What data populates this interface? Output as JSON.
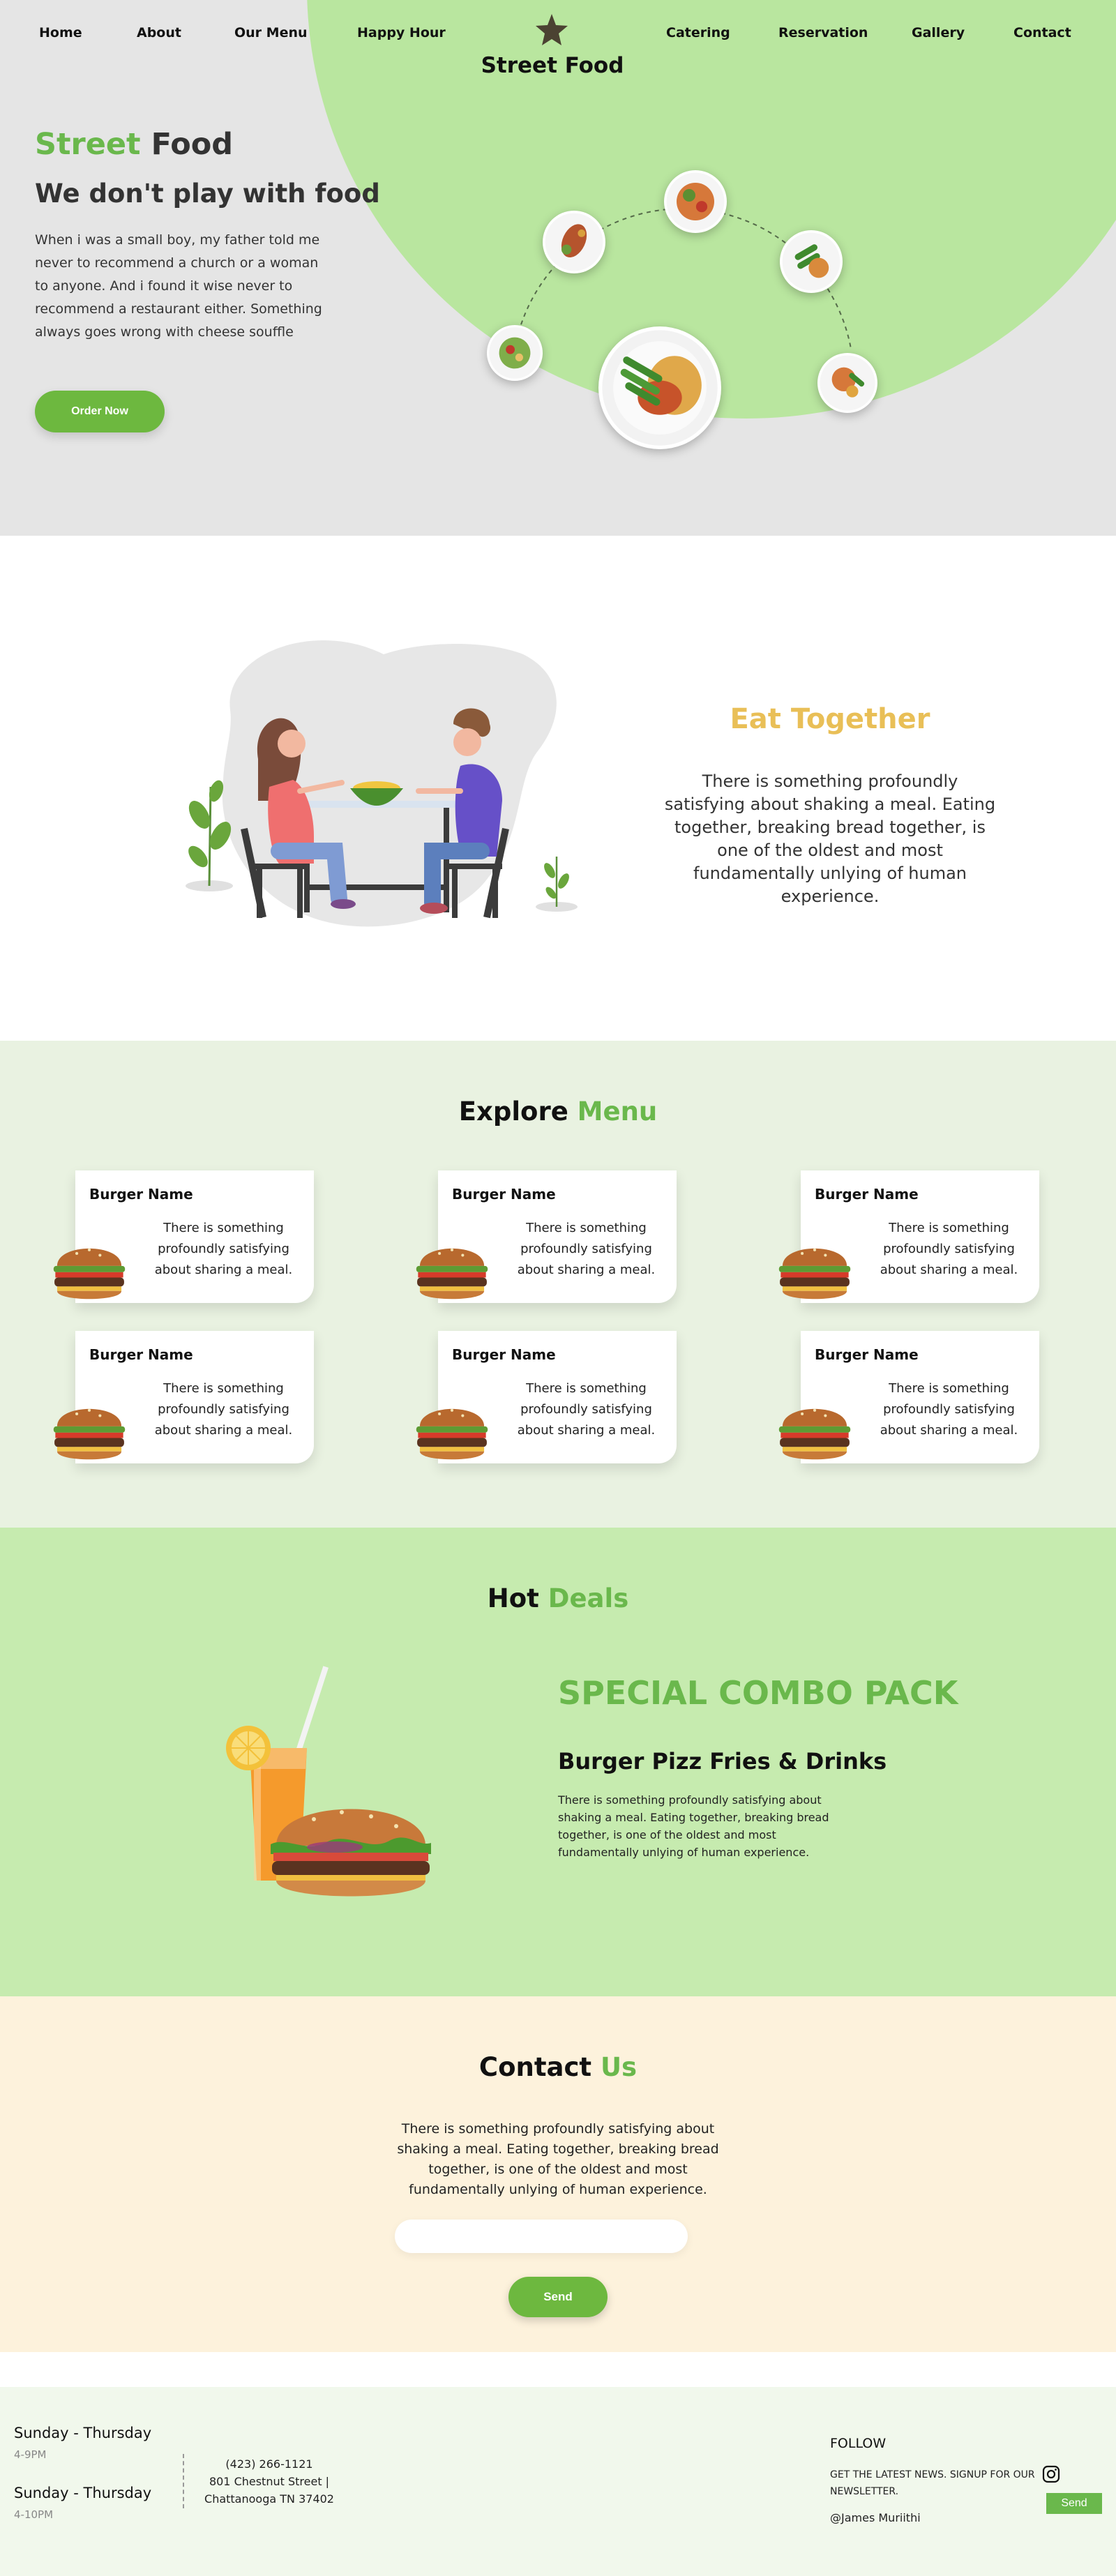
{
  "nav": {
    "left": [
      "Home",
      "About",
      "Our Menu",
      "Happy Hour"
    ],
    "right": [
      "Catering",
      "Reservation",
      "Gallery",
      "Contact"
    ],
    "logo": "Street Food"
  },
  "hero": {
    "title_green": "Street",
    "title_rest": " Food",
    "subtitle": "We don't play with food",
    "text": "When i was a small boy, my father told me never to recommend a church or a woman to anyone. And i found it wise never to recommend a restaurant either. Something always goes wrong with cheese souffle",
    "button": "Order Now"
  },
  "eat": {
    "title": "Eat Together",
    "text": "There is something profoundly satisfying about shaking a meal. Eating together, breaking bread together, is one of the oldest and most fundamentally unlying of human experience."
  },
  "menu": {
    "title_black": "Explore ",
    "title_green": "Menu",
    "cards": [
      {
        "name": "Burger Name",
        "text": "There is something profoundly satisfying about sharing a meal."
      },
      {
        "name": "Burger Name",
        "text": "There is something profoundly satisfying about sharing a meal."
      },
      {
        "name": "Burger Name",
        "text": "There is something profoundly satisfying about sharing a meal."
      },
      {
        "name": "Burger Name",
        "text": "There is something profoundly satisfying about sharing a meal."
      },
      {
        "name": "Burger Name",
        "text": "There is something profoundly satisfying about sharing a meal."
      },
      {
        "name": "Burger Name",
        "text": "There is something profoundly satisfying about sharing a meal."
      }
    ]
  },
  "deals": {
    "title_black": "Hot ",
    "title_green": "Deals",
    "heading": "SPECIAL COMBO PACK",
    "subheading": "Burger Pizz Fries & Drinks",
    "text": "There is something profoundly satisfying about shaking a meal. Eating together, breaking bread together, is one of the oldest and most fundamentally unlying of human experience."
  },
  "contact": {
    "title_black": "Contact ",
    "title_green": "Us",
    "text": "There is something profoundly satisfying about shaking a meal. Eating together, breaking bread together, is one of the oldest and most fundamentally unlying of human experience.",
    "input_value": "",
    "button": "Send"
  },
  "footer": {
    "hours": [
      {
        "days": "Sunday - Thursday",
        "time": "4-9PM"
      },
      {
        "days": "Sunday - Thursday",
        "time": "4-10PM"
      }
    ],
    "phone": "(423) 266-1121",
    "address_line1": "801 Chestnut Street |",
    "address_line2": "Chattanooga TN 37402",
    "follow": "FOLLOW",
    "newsletter": "GET THE LATEST NEWS. SIGNUP FOR OUR NEWSLETTER.",
    "handle": "@James Muriithi",
    "send": "Send"
  },
  "colors": {
    "accent_green": "#6ab84c",
    "hero_blob": "#b9e69f",
    "eat_title": "#e9bf57",
    "menu_bg": "#e9f2e1",
    "deals_bg": "#c6ebaf",
    "contact_bg": "#fdf2dc",
    "footer_bg": "#f1f8ec"
  },
  "icons": [
    "star-logo-icon",
    "instagram-icon",
    "burger-icon",
    "food-plate-icon"
  ]
}
